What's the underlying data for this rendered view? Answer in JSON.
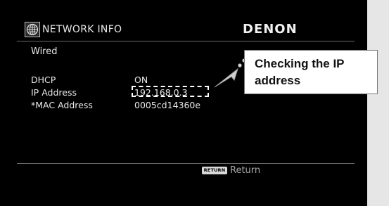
{
  "header": {
    "icon": "globe-icon",
    "title": "NETWORK INFO",
    "brand": "DENON"
  },
  "section": {
    "label": "Wired"
  },
  "info_rows": [
    {
      "label": "DHCP",
      "value": "ON"
    },
    {
      "label": "IP Address",
      "value": "192.168.0.3"
    },
    {
      "label": "*MAC Address",
      "value": "0005cd14360e"
    }
  ],
  "footer": {
    "return_key": "RETURN",
    "return_label": "Return"
  },
  "callout": {
    "text": "Checking the IP address"
  },
  "colors": {
    "screen_bg": "#000000",
    "page_bg": "#e6e6e6",
    "text": "#e8e8e8",
    "callout_bg": "#ffffff"
  }
}
